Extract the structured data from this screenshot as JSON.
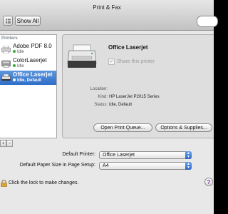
{
  "window": {
    "title": "Print & Fax",
    "show_all_label": "Show All"
  },
  "sidebar": {
    "header": "Printers",
    "printers": [
      {
        "name": "Adobe PDF 8.0",
        "status": "Idle"
      },
      {
        "name": "ColorLaserjet",
        "status": "Idle"
      },
      {
        "name": "Office Laserjet",
        "status": "Idle, Default",
        "selected": true
      }
    ],
    "add_label": "+",
    "remove_label": "−"
  },
  "detail": {
    "printer_name": "Office Laserjet",
    "share_label": "Share this printer",
    "share_checked_glyph": "✓",
    "info": [
      {
        "key": "Location:",
        "value": ""
      },
      {
        "key": "Kind:",
        "value": "HP LaserJet P2015 Series"
      },
      {
        "key": "Status:",
        "value": "Idle, Default"
      }
    ],
    "open_queue_label": "Open Print Queue...",
    "options_label": "Options & Supplies..."
  },
  "settings": {
    "default_printer_label": "Default Printer:",
    "default_printer_value": "Office Laserjet",
    "paper_size_label": "Default Paper Size in Page Setup:",
    "paper_size_value": "A4"
  },
  "footer": {
    "lock_label": "Click the lock to make changes.",
    "help_label": "?"
  },
  "colors": {
    "selection": "#2f6ec8",
    "status_dot": "#3ba93b",
    "help_glyph": "#7a2fa8"
  }
}
